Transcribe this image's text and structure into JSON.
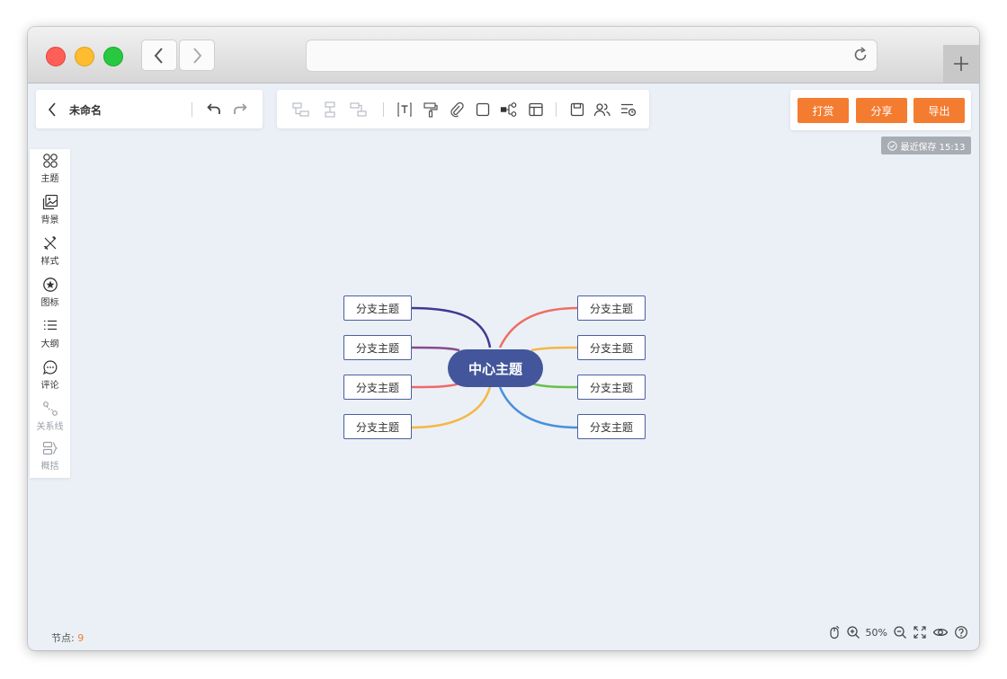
{
  "browser": {
    "url": ""
  },
  "header": {
    "doc_title": "未命名"
  },
  "toolbar": {
    "tools": [
      "child-topic-icon",
      "sibling-topic-icon",
      "parent-topic-icon",
      "text-icon",
      "format-painter-icon",
      "attachment-icon",
      "border-icon",
      "structure-icon",
      "layout-icon",
      "save-icon",
      "collaborate-icon",
      "list-settings-icon"
    ]
  },
  "actions": {
    "reward": "打赏",
    "share": "分享",
    "export": "导出"
  },
  "save_status": "最近保存 15:13",
  "sidebar": {
    "items": [
      {
        "icon": "theme-icon",
        "label": "主题",
        "enabled": true
      },
      {
        "icon": "background-icon",
        "label": "背景",
        "enabled": true
      },
      {
        "icon": "style-icon",
        "label": "样式",
        "enabled": true
      },
      {
        "icon": "marker-icon",
        "label": "图标",
        "enabled": true
      },
      {
        "icon": "outline-icon",
        "label": "大纲",
        "enabled": true
      },
      {
        "icon": "comment-icon",
        "label": "评论",
        "enabled": true
      },
      {
        "icon": "relation-icon",
        "label": "关系线",
        "enabled": false
      },
      {
        "icon": "summary-icon",
        "label": "概括",
        "enabled": false
      }
    ]
  },
  "mindmap": {
    "center": "中心主题",
    "left_branches": [
      {
        "label": "分支主题",
        "color": "#3d3b8e"
      },
      {
        "label": "分支主题",
        "color": "#8a4a8c"
      },
      {
        "label": "分支主题",
        "color": "#ec6a6a"
      },
      {
        "label": "分支主题",
        "color": "#f4b845"
      }
    ],
    "right_branches": [
      {
        "label": "分支主题",
        "color": "#ee6e62"
      },
      {
        "label": "分支主题",
        "color": "#f4b845"
      },
      {
        "label": "分支主题",
        "color": "#6abf4b"
      },
      {
        "label": "分支主题",
        "color": "#4a90d9"
      }
    ]
  },
  "status": {
    "nodes_label": "节点:",
    "nodes_count": "9",
    "zoom": "50%"
  }
}
